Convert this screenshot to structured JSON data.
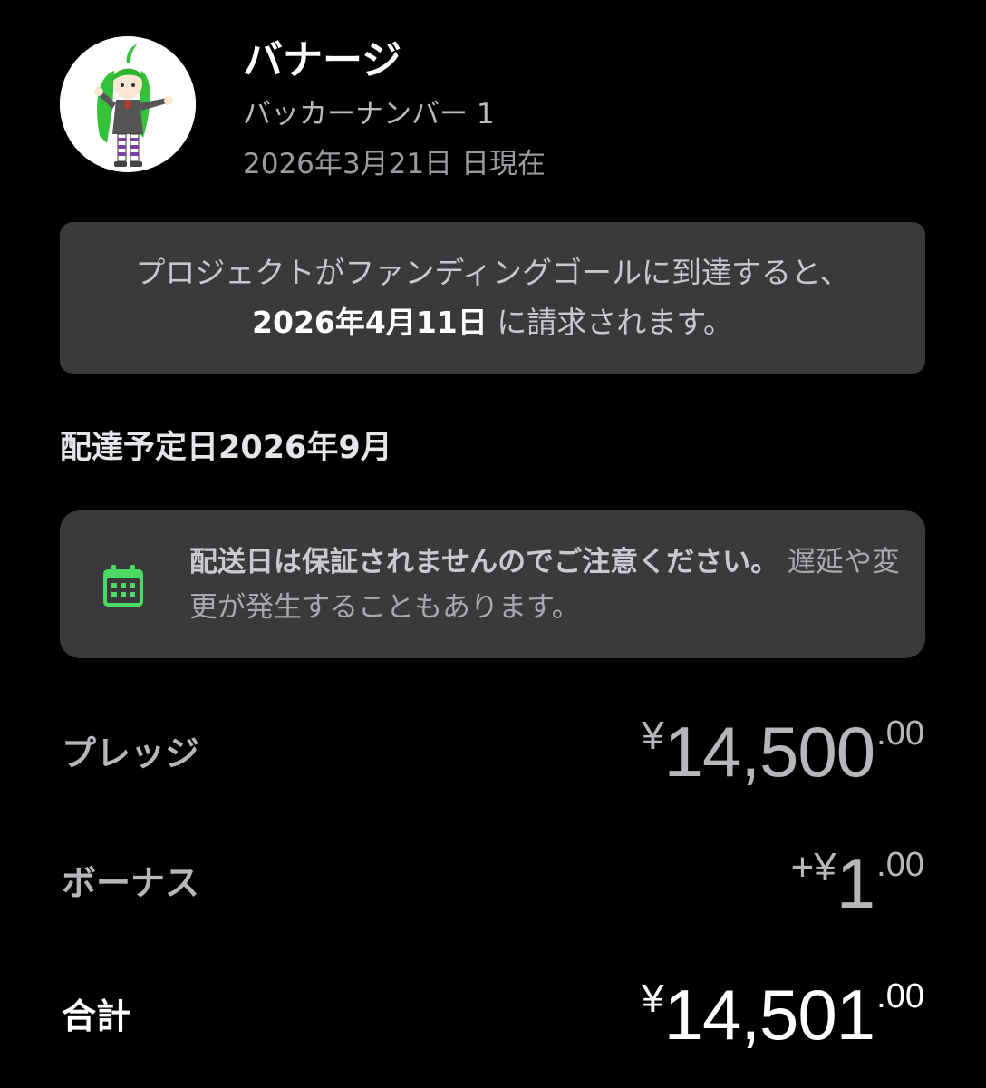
{
  "header": {
    "avatar_icon": "character-avatar",
    "title": "バナージ",
    "backer_number": "バッカーナンバー 1",
    "as_of_date": "2026年3月21日 日現在"
  },
  "charge_notice": {
    "text_before": "プロジェクトがファンディングゴールに到達すると、",
    "charge_date": "2026年4月11日",
    "text_after": " に請求されます。"
  },
  "delivery": {
    "heading": "配達予定日2026年9月",
    "warning_icon": "calendar-icon",
    "warning_bold": "配送日は保証されませんのでご注意ください。",
    "warning_rest": " 遅延や変更が発生することもあります。",
    "icon_color": "#4cd964"
  },
  "amounts": {
    "pledge": {
      "label": "プレッジ",
      "sign": "¥",
      "main": "14,500",
      "cents": ".00"
    },
    "bonus": {
      "label": "ボーナス",
      "sign": "+¥",
      "main": "1",
      "cents": ".00"
    },
    "total": {
      "label": "合計",
      "sign": "¥",
      "main": "14,501",
      "cents": ".00"
    }
  }
}
